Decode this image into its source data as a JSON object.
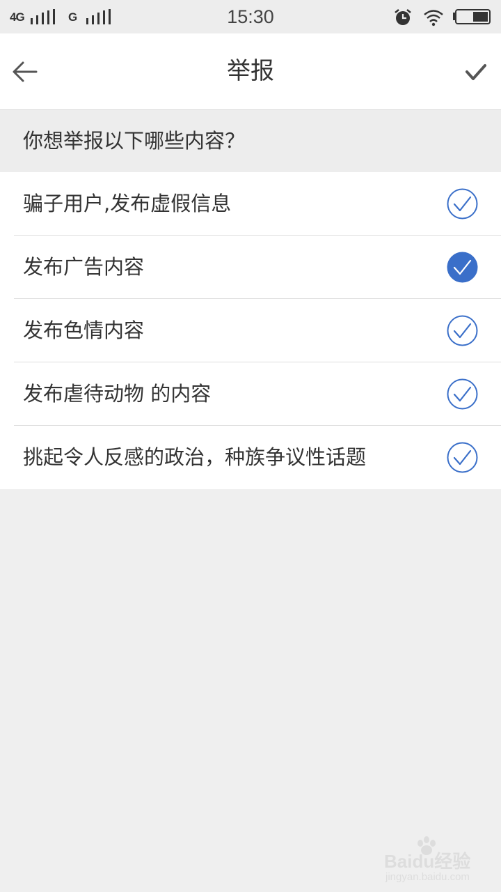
{
  "status_bar": {
    "network_1": "4G",
    "network_2": "G",
    "time": "15:30",
    "icons": [
      "signal-icon",
      "alarm-icon",
      "wifi-icon",
      "battery-icon"
    ]
  },
  "header": {
    "title": "举报",
    "back_icon": "arrow-left-icon",
    "confirm_icon": "checkmark-icon"
  },
  "question": "你想举报以下哪些内容？",
  "options": [
    {
      "label": "骗子用户,发布虚假信息",
      "checked": false
    },
    {
      "label": "发布广告内容",
      "checked": true
    },
    {
      "label": "发布色情内容",
      "checked": false
    },
    {
      "label": "发布虐待动物 的内容",
      "checked": false
    },
    {
      "label": "挑起令人反感的政治，种族争议性话题",
      "checked": false
    }
  ],
  "watermark": {
    "brand": "Baidu经验",
    "url": "jingyan.baidu.com"
  },
  "colors": {
    "accent": "#3a6fc9",
    "background": "#efefef",
    "surface": "#ffffff",
    "text": "#333333"
  }
}
